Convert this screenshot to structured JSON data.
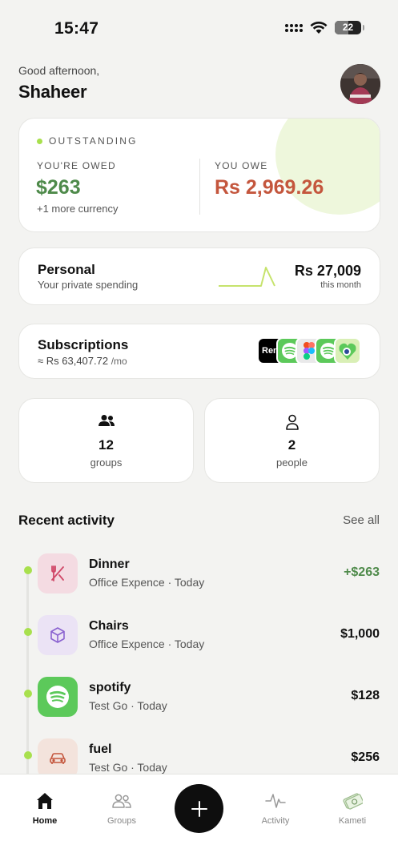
{
  "status_bar": {
    "time": "15:47",
    "battery": "22"
  },
  "header": {
    "greeting": "Good afternoon,",
    "username": "Shaheer"
  },
  "balance": {
    "outstanding_label": "OUTSTANDING",
    "owed_label": "YOU'RE OWED",
    "owed_value": "$263",
    "owed_more": "+1 more currency",
    "owe_label": "YOU OWE",
    "owe_value": "Rs 2,969.26"
  },
  "personal": {
    "title": "Personal",
    "subtitle": "Your private spending",
    "amount": "Rs 27,009",
    "period": "this month"
  },
  "subscriptions": {
    "title": "Subscriptions",
    "amount": "≈ Rs 63,407.72",
    "per": "/mo",
    "icons": [
      {
        "name": "rent-icon",
        "label": "Ren"
      },
      {
        "name": "spotify-icon"
      },
      {
        "name": "figma-icon"
      },
      {
        "name": "spotify-icon"
      },
      {
        "name": "heart-shield-icon"
      }
    ]
  },
  "stats": {
    "groups": {
      "value": "12",
      "label": "groups"
    },
    "people": {
      "value": "2",
      "label": "people"
    }
  },
  "recent_activity": {
    "title": "Recent activity",
    "see_all": "See all",
    "items": [
      {
        "name": "Dinner",
        "meta": "Office Expence · Today",
        "amount": "+$263",
        "icon": "fork-knife-icon",
        "color": "#f4dbe2"
      },
      {
        "name": "Chairs",
        "meta": "Office Expence · Today",
        "amount": "$1,000",
        "icon": "cube-icon",
        "color": "#ebe3f5"
      },
      {
        "name": "spotify",
        "meta": "Test Go · Today",
        "amount": "$128",
        "icon": "spotify-icon",
        "color": "#5cc95a"
      },
      {
        "name": "fuel",
        "meta": "Test Go · Today",
        "amount": "$256",
        "icon": "car-icon",
        "color": "#f3e3dc"
      }
    ]
  },
  "nav": {
    "home": "Home",
    "groups": "Groups",
    "activity": "Activity",
    "kameti": "Kameti"
  },
  "colors": {
    "accent_green": "#a8e04d",
    "positive": "#4e8a4a",
    "negative": "#c4563d",
    "background": "#f3f3f1"
  }
}
